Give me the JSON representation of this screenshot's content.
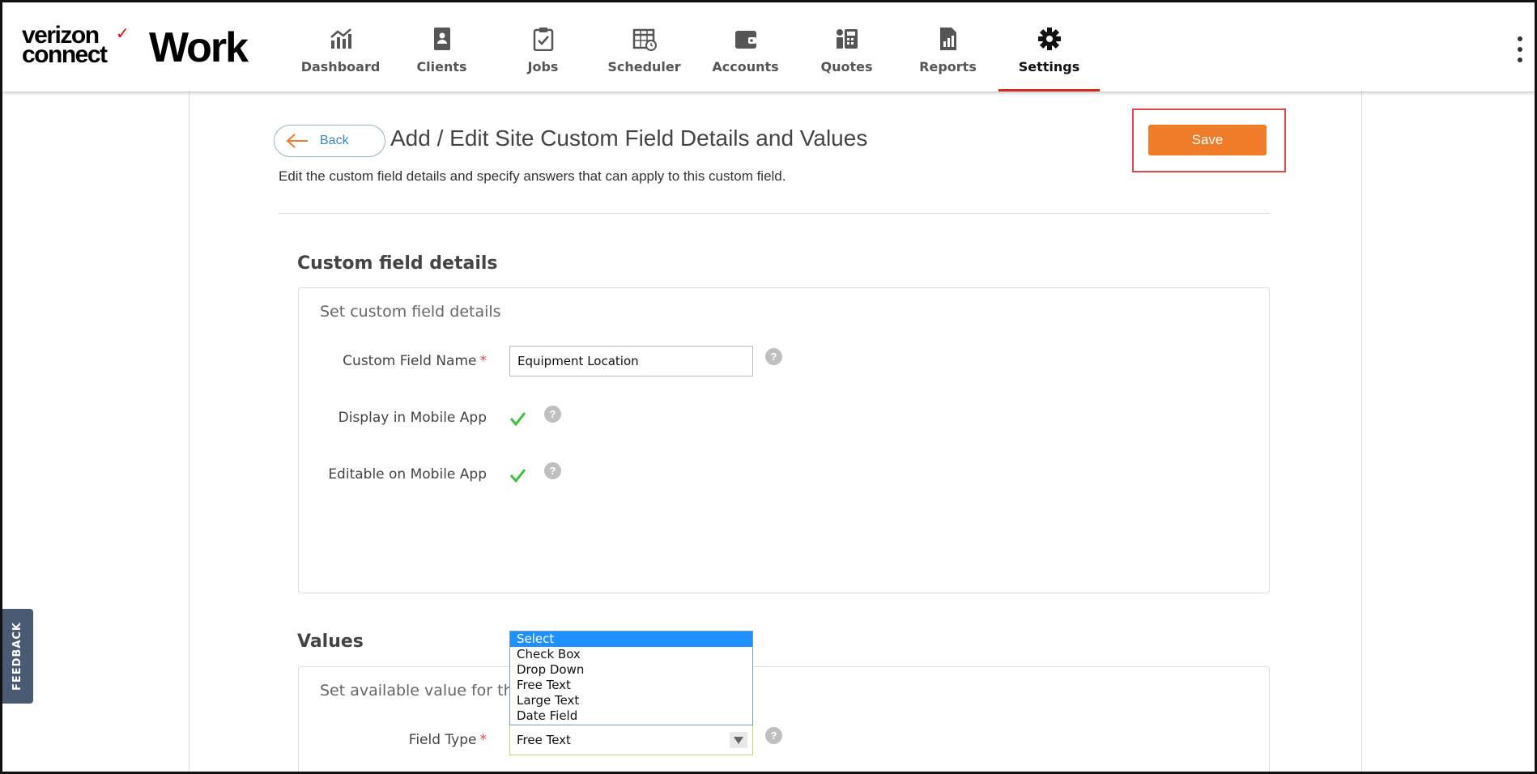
{
  "brand": {
    "line1": "verizon",
    "line2": "connect",
    "product": "Work"
  },
  "nav": {
    "items": [
      {
        "label": "Dashboard",
        "icon": "dashboard-chart-icon"
      },
      {
        "label": "Clients",
        "icon": "clients-book-icon"
      },
      {
        "label": "Jobs",
        "icon": "jobs-clipboard-icon"
      },
      {
        "label": "Scheduler",
        "icon": "scheduler-calendar-icon"
      },
      {
        "label": "Accounts",
        "icon": "accounts-wallet-icon"
      },
      {
        "label": "Quotes",
        "icon": "quotes-calculator-icon"
      },
      {
        "label": "Reports",
        "icon": "reports-document-icon"
      },
      {
        "label": "Settings",
        "icon": "settings-gear-icon"
      }
    ],
    "active": "Settings"
  },
  "header": {
    "back_label": "Back",
    "title": "Add / Edit Site Custom Field Details and Values",
    "subtitle": "Edit the custom field details and specify answers that can apply to this custom field.",
    "save_label": "Save"
  },
  "details": {
    "section_title": "Custom field details",
    "panel_title": "Set custom field details",
    "name_label": "Custom Field Name",
    "name_value": "Equipment Location",
    "mobile_label": "Display in Mobile App",
    "mobile_checked": true,
    "editable_label": "Editable on Mobile App",
    "editable_checked": true,
    "required_mark": "*",
    "help_mark": "?"
  },
  "values": {
    "section_title": "Values",
    "panel_title": "Set available value for this",
    "field_type_label": "Field Type",
    "field_type_value": "Free Text",
    "options": [
      "Select",
      "Check Box",
      "Drop Down",
      "Free Text",
      "Large Text",
      "Date Field"
    ],
    "highlighted_option": "Select"
  },
  "feedback_label": "FEEDBACK",
  "colors": {
    "accent": "#ee7c28",
    "active_underline": "#d52b1e",
    "link": "#3a86c8",
    "highlight": "#1e90ff"
  }
}
